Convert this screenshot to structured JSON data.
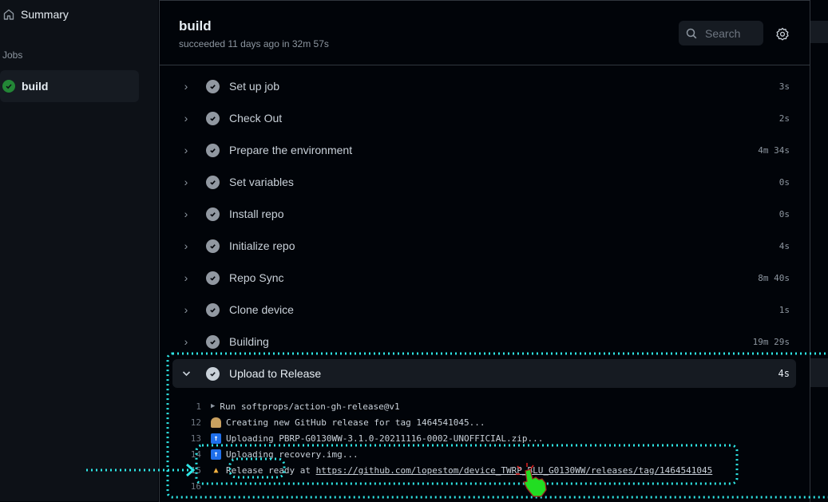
{
  "sidebar": {
    "summary_label": "Summary",
    "jobs_heading": "Jobs",
    "jobs": [
      {
        "label": "build",
        "status": "success"
      }
    ]
  },
  "header": {
    "title": "build",
    "subtitle": "succeeded 11 days ago in 32m 57s",
    "search_placeholder": "Search"
  },
  "steps": [
    {
      "name": "Set up job",
      "duration": "3s",
      "expanded": false
    },
    {
      "name": "Check Out",
      "duration": "2s",
      "expanded": false
    },
    {
      "name": "Prepare the environment",
      "duration": "4m 34s",
      "expanded": false
    },
    {
      "name": "Set variables",
      "duration": "0s",
      "expanded": false
    },
    {
      "name": "Install repo",
      "duration": "0s",
      "expanded": false
    },
    {
      "name": "Initialize repo",
      "duration": "4s",
      "expanded": false
    },
    {
      "name": "Repo Sync",
      "duration": "8m 40s",
      "expanded": false
    },
    {
      "name": "Clone device",
      "duration": "1s",
      "expanded": false
    },
    {
      "name": "Building",
      "duration": "19m 29s",
      "expanded": false
    },
    {
      "name": "Upload to Release",
      "duration": "4s",
      "expanded": true
    }
  ],
  "log": [
    {
      "num": "1",
      "icon": "triangle",
      "text": "Run softprops/action-gh-release@v1"
    },
    {
      "num": "12",
      "icon": "person",
      "text": "Creating new GitHub release for tag 1464541045..."
    },
    {
      "num": "13",
      "icon": "up-arrow",
      "text": "Uploading PBRP-G0130WW-3.1.0-20211116-0002-UNOFFICIAL.zip..."
    },
    {
      "num": "14",
      "icon": "up-arrow",
      "text": "Uploading recovery.img..."
    },
    {
      "num": "15",
      "icon": "party",
      "text": "Release ready at ",
      "link": "https://github.com/lopestom/device_TWRP_BLU_G0130WW/releases/tag/1464541045"
    },
    {
      "num": "16",
      "icon": "",
      "text": ""
    }
  ],
  "colors": {
    "success": "#238636",
    "annotation": "#2ee6e6",
    "cursor": "#22dd22"
  }
}
